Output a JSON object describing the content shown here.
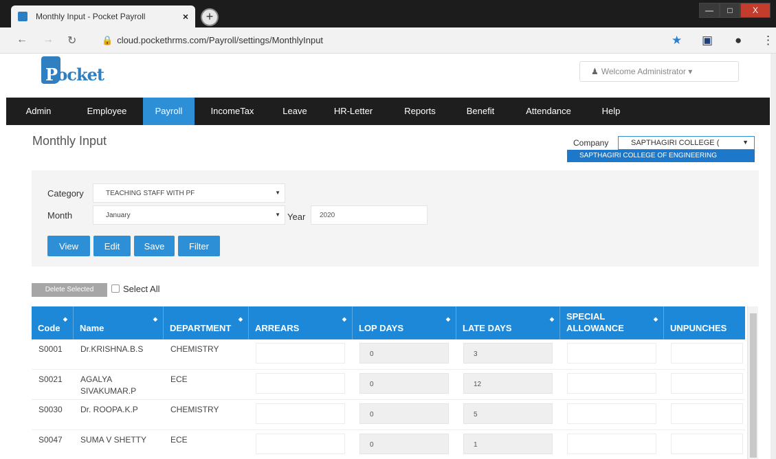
{
  "browser": {
    "tab_title": "Monthly Input - Pocket Payroll",
    "tab_close": "×",
    "new_tab": "+",
    "url": "cloud.pockethrms.com/Payroll/settings/MonthlyInput",
    "window_min": "—",
    "window_max": "□",
    "window_close": "X"
  },
  "logo": {
    "text": "Pocket"
  },
  "header": {
    "welcome": "Welcome Administrator ▾"
  },
  "nav": {
    "items": [
      "Admin",
      "Employee",
      "Payroll",
      "IncomeTax",
      "Leave",
      "HR-Letter",
      "Reports",
      "Benefit",
      "Attendance",
      "Help"
    ],
    "active": "Payroll"
  },
  "page": {
    "title": "Monthly Input",
    "company_label": "Company",
    "company_value": "SAPTHAGIRI COLLEGE (",
    "company_option": "SAPTHAGIRI COLLEGE OF ENGINEERING"
  },
  "filters": {
    "category_label": "Category",
    "category_value": "TEACHING STAFF WITH PF",
    "month_label": "Month",
    "month_value": "January",
    "year_label": "Year",
    "year_value": "2020",
    "buttons": {
      "view": "View",
      "edit": "Edit",
      "save": "Save",
      "filter": "Filter"
    }
  },
  "actions": {
    "delete_selected": "Delete Selected",
    "select_all": "Select All"
  },
  "grid": {
    "columns": [
      "Code",
      "Name",
      "DEPARTMENT",
      "ARREARS",
      "LOP DAYS",
      "LATE DAYS",
      "SPECIAL ALLOWANCE",
      "UNPUNCHES"
    ],
    "rows": [
      {
        "code": "S0001",
        "name": "Dr.KRISHNA.B.S",
        "department": "CHEMISTRY",
        "lop": "0",
        "late": "3"
      },
      {
        "code": "S0021",
        "name": "AGALYA SIVAKUMAR.P",
        "department": "ECE",
        "lop": "0",
        "late": "12"
      },
      {
        "code": "S0030",
        "name": "Dr. ROOPA.K.P",
        "department": "CHEMISTRY",
        "lop": "0",
        "late": "5"
      },
      {
        "code": "S0047",
        "name": "SUMA V SHETTY",
        "department": "ECE",
        "lop": "0",
        "late": "1"
      }
    ]
  },
  "icons": {
    "back": "←",
    "forward": "→",
    "reload": "↻",
    "lock": "🔒",
    "star": "★",
    "extension": "▣",
    "profile": "●",
    "menu": "⋮",
    "user": "👤",
    "dropdown": "▾",
    "sort": "◆"
  },
  "colors": {
    "accent": "#2d8fd6",
    "nav_bg": "#1e1e1e",
    "option_bg": "#1e78c9"
  }
}
